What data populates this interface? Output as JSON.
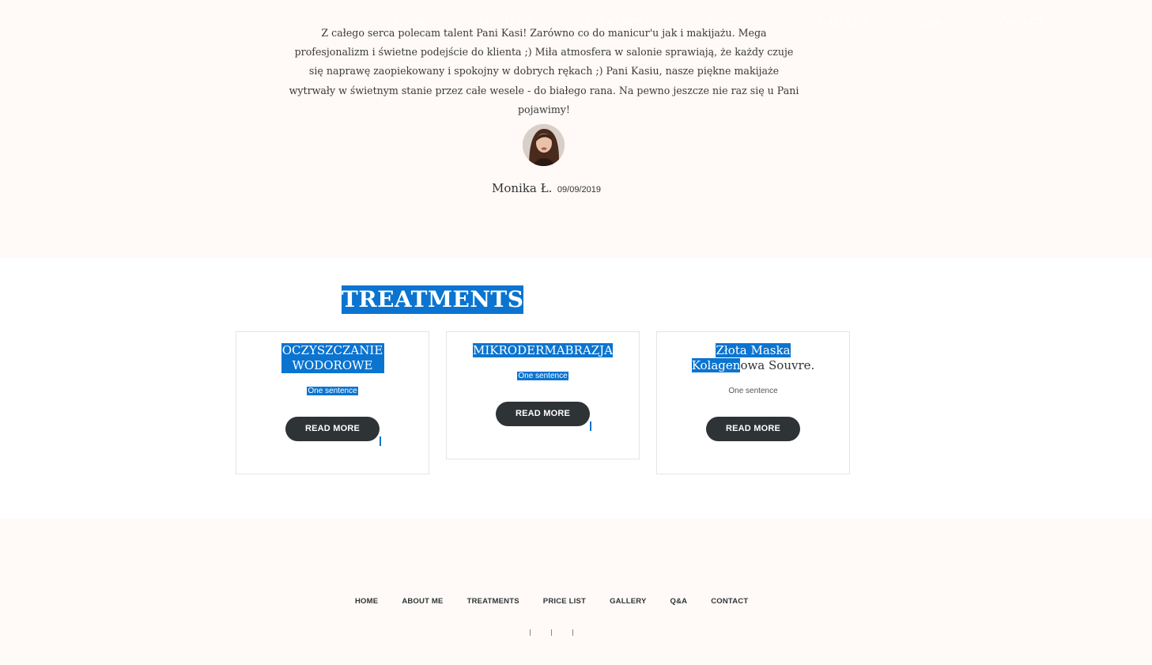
{
  "header_nav": {
    "items": [
      "HOME",
      "ABOUT ME",
      "TREATMENTS",
      "PRICE LIST",
      "GALLERY",
      "Q&A",
      "CONTACT"
    ]
  },
  "testimonial": {
    "quote": "Z całego serca polecam talent Pani Kasi! Zarówno co do manicur'u jak i makijażu. Mega profesjonalizm i świetne podejście do klienta ;) Miła atmosfera w salonie sprawiają, że każdy czuje się naprawę zaopiekowany i spokojny w dobrych rękach ;) Pani Kasiu, nasze piękne makijaże wytrwały w świetnym stanie przez całe wesele - do białego rana. Na pewno jeszcze nie raz się u Pani pojawimy!",
    "author": "Monika Ł.",
    "date": "09/09/2019"
  },
  "treatments": {
    "title": "TREATMENTS",
    "cards": [
      {
        "title": "OCZYSZCZANIE WODOROWE",
        "subtitle": "One sentence",
        "button": "READ MORE"
      },
      {
        "title": "MIKRODERMABRAZJA",
        "subtitle": "One sentence",
        "button": "READ MORE"
      },
      {
        "title_highlight": "Złota Maska Kolagen",
        "title_rest": "owa Souvre.",
        "subtitle": "One sentence",
        "button": "READ MORE"
      }
    ]
  },
  "footer_nav": {
    "items": [
      "HOME",
      "ABOUT ME",
      "TREATMENTS",
      "PRICE LIST",
      "GALLERY",
      "Q&A",
      "CONTACT"
    ]
  },
  "colors": {
    "selection": "#0a74d0",
    "button": "#2e3336",
    "section_bg": "#fff9f7"
  }
}
